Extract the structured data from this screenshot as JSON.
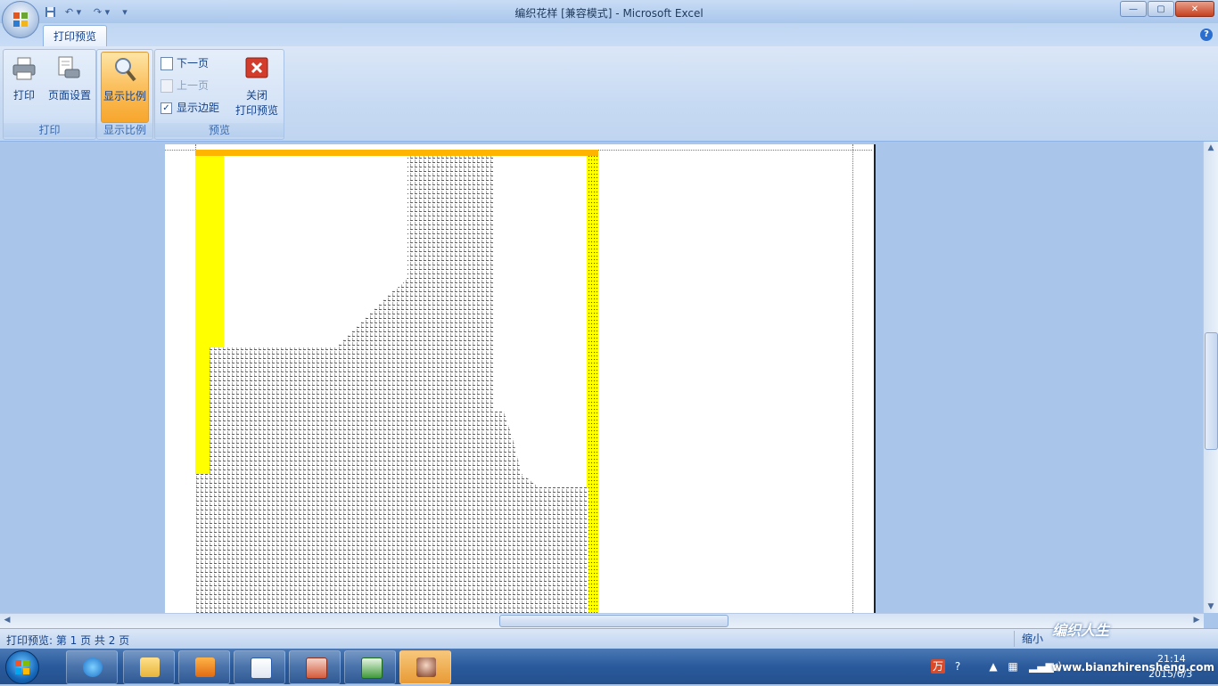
{
  "window": {
    "title": "编织花样  [兼容模式] - Microsoft Excel",
    "controls": {
      "minimize": "—",
      "maximize": "▢",
      "close": "✕"
    }
  },
  "qat": {
    "save_icon": "save-icon",
    "undo_icon": "undo-icon",
    "redo_icon": "redo-icon",
    "customize_icon": "chevron-down-icon"
  },
  "tabs": {
    "active": "打印预览"
  },
  "ribbon": {
    "print_group": {
      "label": "打印",
      "print_button": "打印",
      "page_setup_button": "页面设置"
    },
    "zoom_group": {
      "label": "显示比例",
      "zoom_button": "显示比例"
    },
    "preview_group": {
      "label": "预览",
      "next_page": "下一页",
      "prev_page": "上一页",
      "show_margins": "显示边距",
      "show_margins_checked": true,
      "close_line1": "关闭",
      "close_line2": "打印预览"
    }
  },
  "status": {
    "text": "打印预览: 第 1 页  共 2 页",
    "zoom_out": "缩小"
  },
  "taskbar": {
    "items": [
      "internet-explorer-icon",
      "file-explorer-icon",
      "media-player-icon",
      "word-icon",
      "powerpoint-icon",
      "excel-icon",
      "photo-icon"
    ],
    "clock_time": "21:14",
    "clock_date": "2015/6/3"
  },
  "watermark": {
    "brand": "编织人生",
    "url": "www.bianzhirensheng.com"
  },
  "colors": {
    "highlight": "#ffff00",
    "orange_header": "#ffb400",
    "ribbon_active": "#fbbf5c"
  }
}
